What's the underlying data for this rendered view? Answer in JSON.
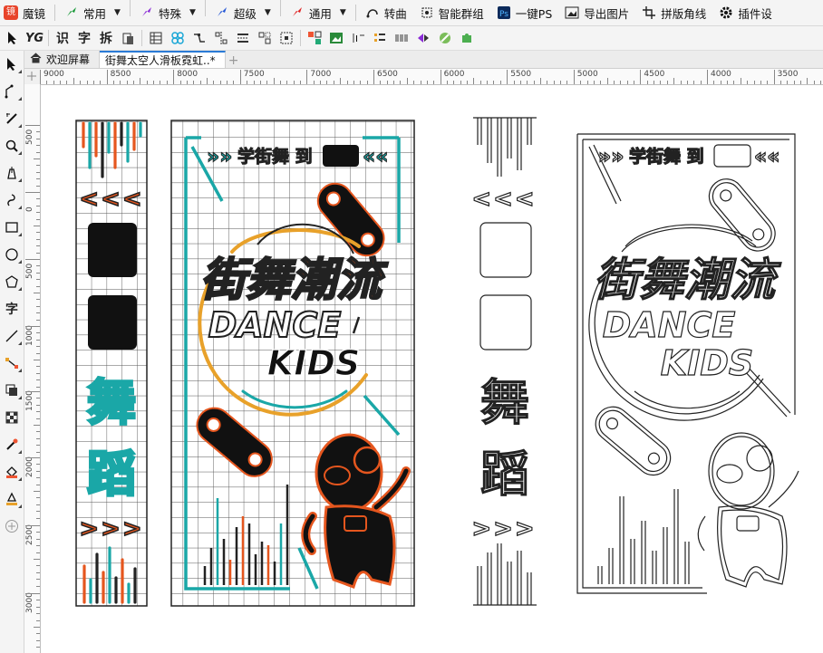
{
  "app": {
    "name": "魔镜"
  },
  "menu": {
    "items": [
      {
        "label": "常用",
        "icon": "arrow-green-icon",
        "color": "#1b9a3b"
      },
      {
        "label": "特殊",
        "icon": "arrow-purple-icon",
        "color": "#8a2bd6"
      },
      {
        "label": "超级",
        "icon": "arrow-blue-icon",
        "color": "#2457d6"
      },
      {
        "label": "通用",
        "icon": "arrow-red-icon",
        "color": "#e02222"
      }
    ],
    "actions": [
      {
        "label": "转曲",
        "icon": "curve-convert-icon"
      },
      {
        "label": "智能群组",
        "icon": "smart-group-icon"
      },
      {
        "label": "一键PS",
        "icon": "ps-icon",
        "badge": "Ps"
      },
      {
        "label": "导出图片",
        "icon": "export-image-icon"
      },
      {
        "label": "拼版角线",
        "icon": "crop-marks-icon"
      },
      {
        "label": "插件设",
        "icon": "plugin-gear-icon"
      }
    ]
  },
  "toolbar": {
    "text_buttons": [
      "识",
      "字",
      "拆"
    ]
  },
  "tabs": [
    {
      "label": "欢迎屏幕",
      "icon": "home-icon"
    },
    {
      "label": "街舞太空人滑板霓虹..*",
      "active": true
    }
  ],
  "ruler": {
    "h_labels": [
      "9000",
      "8500",
      "8000",
      "7500",
      "7000",
      "6500",
      "6000",
      "5500",
      "5000",
      "4500",
      "4000",
      "3500"
    ],
    "v_labels": [
      "500",
      "0",
      "500",
      "1000",
      "1500",
      "2000",
      "2500",
      "3000"
    ]
  },
  "artwork": {
    "banner_top": "学街舞 到",
    "title_cn": "街舞潮流",
    "title_en_1": "DANCE",
    "title_en_2": "KIDS",
    "vertical_chars": [
      "舞",
      "蹈"
    ],
    "chevrons_left": "<<<",
    "chevrons_right": ">>>",
    "banner_quotes_left": "»»",
    "banner_quotes_right": "««"
  },
  "colors": {
    "teal": "#1aa7a7",
    "orange": "#e5561e",
    "yellow": "#e8a12a",
    "grid": "#555555",
    "accent_blue": "#2b7bd6"
  }
}
